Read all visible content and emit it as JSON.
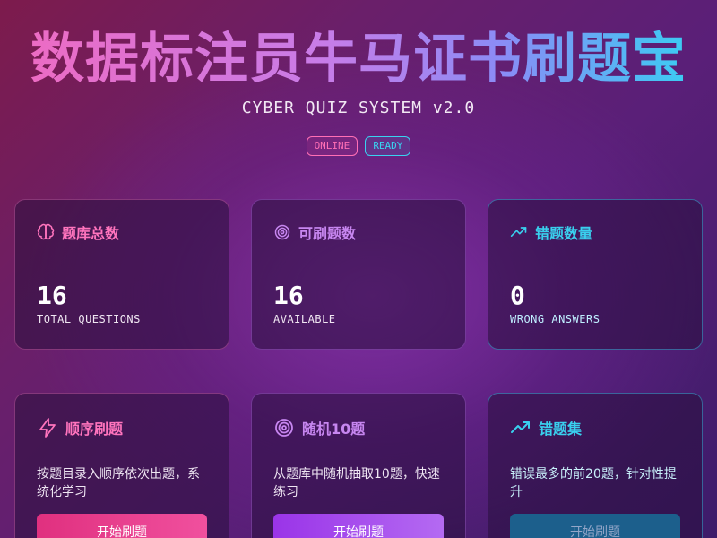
{
  "header": {
    "title": "数据标注员牛马证书刷题宝",
    "subtitle": "CYBER QUIZ SYSTEM v2.0",
    "badges": [
      "ONLINE",
      "READY"
    ]
  },
  "stats": [
    {
      "label": "题库总数",
      "value": "16",
      "sub": "TOTAL QUESTIONS",
      "icon": "brain-icon",
      "color": "#ff74bd"
    },
    {
      "label": "可刷题数",
      "value": "16",
      "sub": "AVAILABLE",
      "icon": "target-icon",
      "color": "#c786f0"
    },
    {
      "label": "错题数量",
      "value": "0",
      "sub": "WRONG ANSWERS",
      "icon": "trending-up-icon",
      "color": "#39d0ee"
    }
  ],
  "modes": [
    {
      "title": "顺序刷题",
      "desc": "按题目录入顺序依次出题，系统化学习",
      "button": "开始刷题",
      "icon": "lightning-icon",
      "color": "#ff74bd"
    },
    {
      "title": "随机10题",
      "desc": "从题库中随机抽取10题，快速练习",
      "button": "开始刷题",
      "icon": "target-icon",
      "color": "#c786f0"
    },
    {
      "title": "错题集",
      "desc": "错误最多的前20题，针对性提升",
      "button": "开始刷题",
      "icon": "trending-up-icon",
      "color": "#39d0ee"
    }
  ]
}
